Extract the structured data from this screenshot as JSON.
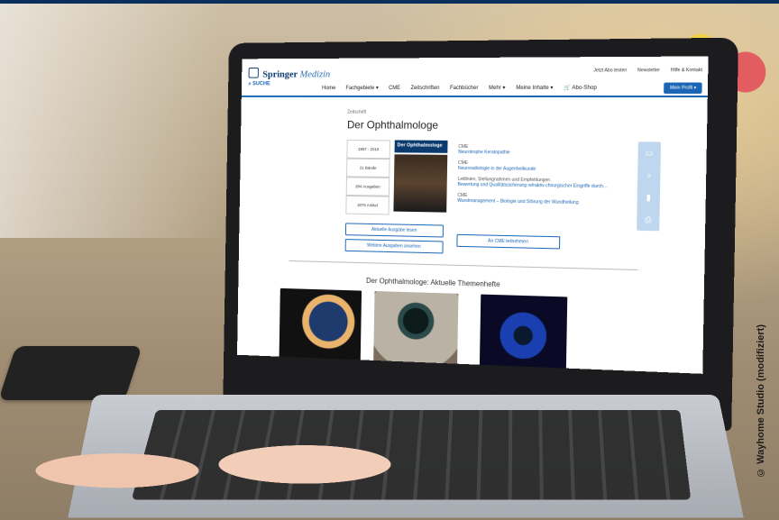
{
  "site": {
    "brand": "Springer",
    "brand_sub": "Medizin",
    "top_links": [
      "Jetzt Abo testen",
      "Newsletter",
      "Hilfe & Kontakt"
    ],
    "search_label": "SUCHE",
    "nav": [
      "Home",
      "Fachgebiete ▾",
      "CME",
      "Zeitschriften",
      "Fachbücher",
      "Mehr ▾",
      "Meine Inhalte ▾",
      "🛒 Abo-Shop"
    ],
    "profile_button": "Mein Profil ▾"
  },
  "journal": {
    "kicker": "Zeitschrift",
    "title": "Der Ophthalmologe",
    "cover_title": "Der Ophthalmologe",
    "stats": [
      "1997 - 2018",
      "21 Bände",
      "284 Ausgaben",
      "4076 Artikel"
    ],
    "articles": [
      {
        "kicker": "CME",
        "title": "Neurotrophe Keratopathie"
      },
      {
        "kicker": "CME",
        "title": "Neuroradiologie in der Augenheilkunde"
      },
      {
        "kicker": "Leitlinien, Stellungnahmen und Empfehlungen",
        "title": "Bewertung und Qualitätssicherung refraktiv-chirurgischer Eingriffe durch..."
      },
      {
        "kicker": "CME",
        "title": "Wundmanagement – Biologie und Störung der Wundheilung"
      }
    ],
    "buttons": {
      "current_issue": "Aktuelle Ausgabe lesen",
      "more_issues": "Weitere Ausgaben ansehen",
      "cme": "An CME teilnehmen"
    },
    "section_title": "Der Ophthalmologe: Aktuelle Themenhefte"
  },
  "tools": [
    "document-icon",
    "search-icon",
    "bookmark-icon",
    "print-icon"
  ],
  "photo_credit": "© Wayhome Studio (modifiziert)",
  "colors": {
    "accent": "#1a66b5",
    "brand": "#0b3a6e",
    "topbar": "#0b2f5c"
  }
}
